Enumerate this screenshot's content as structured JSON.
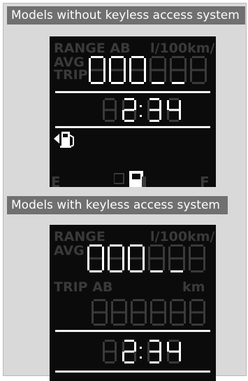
{
  "section1": {
    "header": "Models without keyless access system",
    "range_ab": "RANGE AB",
    "avg": "AVG",
    "trip": "TRIP",
    "unit": "l/100km/l",
    "clock": "12:34",
    "gauge_e": "E",
    "gauge_f": "F",
    "gauge_level": 0.55
  },
  "section2": {
    "header": "Models with keyless access system",
    "range": "RANGE",
    "unit": "l/100km/l",
    "avg": "AVG",
    "trip_ab": "TRIP  AB",
    "km": "km",
    "clock": "12:34"
  },
  "colors": {
    "lit": "#ffffff",
    "dim": "#3a3a3a",
    "panel": "#0b0b0b",
    "header": "#707070"
  }
}
